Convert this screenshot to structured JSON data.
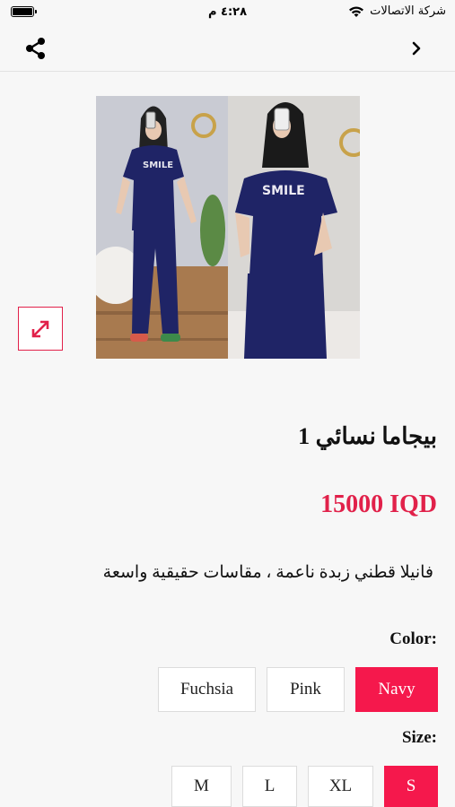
{
  "status_bar": {
    "carrier": "شركة الاتصالات",
    "time": "٤:٢٨ م"
  },
  "nav": {
    "share_icon": "share-icon",
    "back_icon": "chevron-right-icon"
  },
  "product": {
    "title": "بيجاما نسائي 1",
    "price": "15000 IQD",
    "description": "فانيلا قطني زبدة ناعمة ، مقاسات حقيقية واسعة",
    "image_alt_icon": "expand-icon"
  },
  "options": {
    "color_label": "Color:",
    "colors": [
      {
        "label": "Fuchsia",
        "selected": false
      },
      {
        "label": "Pink",
        "selected": false
      },
      {
        "label": "Navy",
        "selected": true
      }
    ],
    "size_label": "Size:",
    "sizes": [
      {
        "label": "M",
        "selected": false
      },
      {
        "label": "L",
        "selected": false
      },
      {
        "label": "XL",
        "selected": false
      },
      {
        "label": "S",
        "selected": true
      }
    ]
  },
  "colors": {
    "accent": "#e1214a",
    "selected_bg": "#f5184c"
  }
}
